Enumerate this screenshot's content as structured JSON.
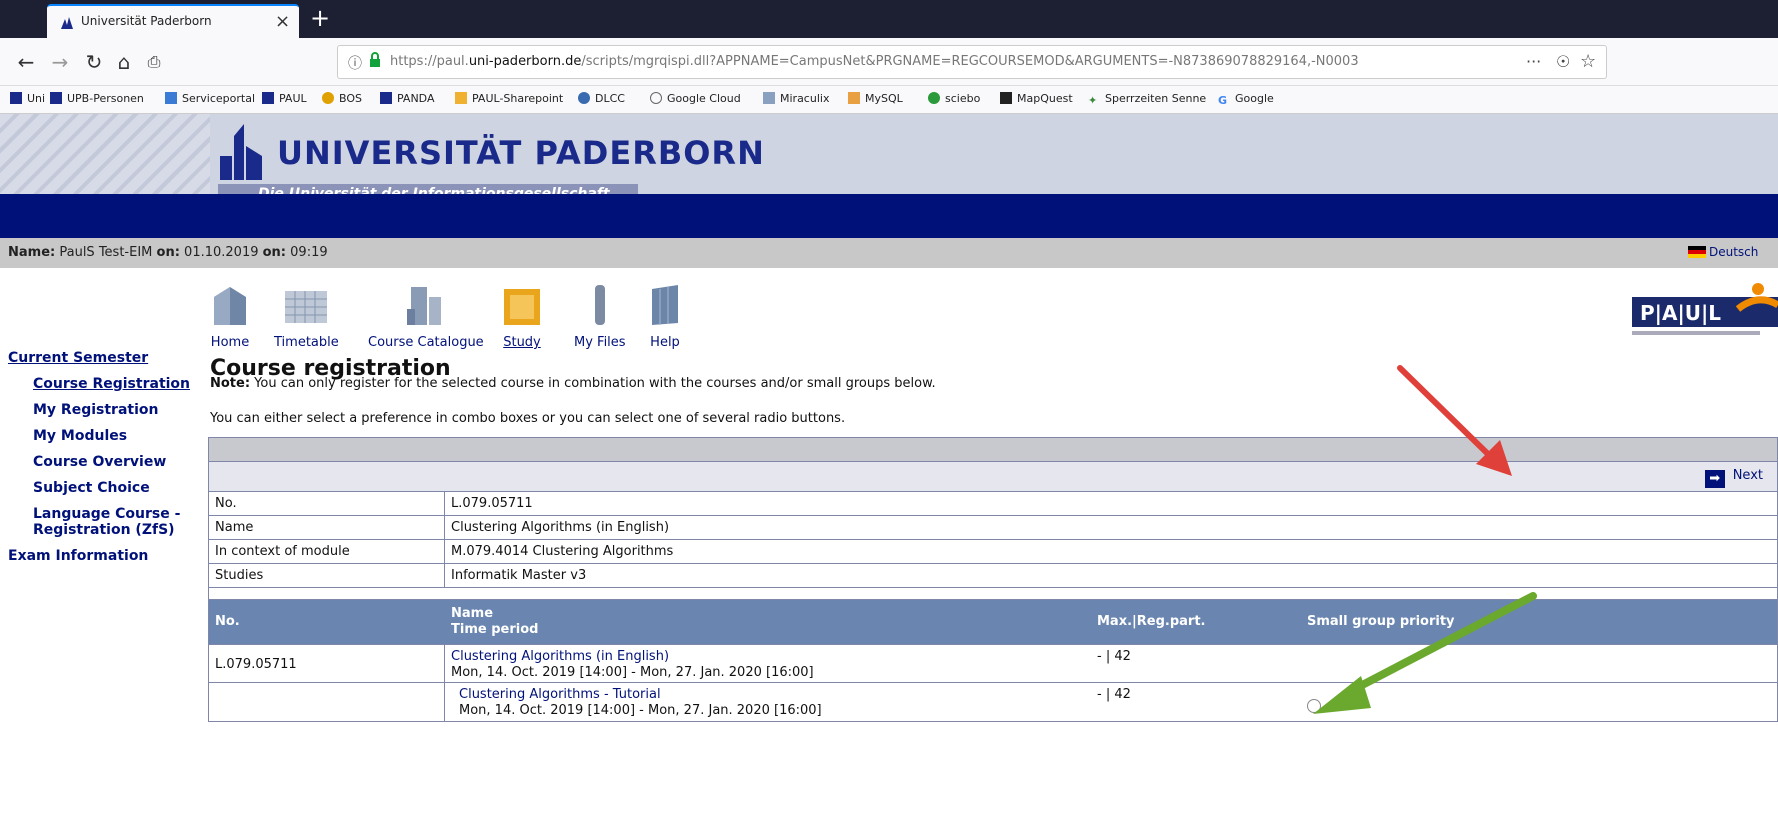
{
  "browser": {
    "tab_title": "Universität Paderborn",
    "tab_close": "×",
    "new_tab": "+",
    "url_prefix": "https://paul.",
    "url_domain": "uni-paderborn.de",
    "url_rest": "/scripts/mgrqispi.dll?APPNAME=CampusNet&PRGNAME=REGCOURSEMOD&ARGUMENTS=-N873869078829164,-N0003",
    "bookmarks": [
      "Uni",
      "UPB-Personen",
      "Serviceportal",
      "PAUL",
      "BOS",
      "PANDA",
      "PAUL-Sharepoint",
      "DLCC",
      "Google Cloud",
      "Miraculix",
      "MySQL",
      "sciebo",
      "MapQuest",
      "Sperrzeiten Senne",
      "Google"
    ]
  },
  "header": {
    "uni_name": "UNIVERSITÄT PADERBORN",
    "uni_sub": "Die Universität der Informationsgesellschaft"
  },
  "infobar": {
    "name_label": "Name:",
    "name_value": "PaulS Test-EIM",
    "on1_label": "on:",
    "date": "01.10.2019",
    "on2_label": "on:",
    "time": "09:19",
    "language": "Deutsch"
  },
  "nav": {
    "home": "Home",
    "timetable": "Timetable",
    "catalogue": "Course Catalogue",
    "study": "Study",
    "files": "My Files",
    "help": "Help"
  },
  "sidebar": {
    "current_semester": "Current Semester",
    "course_registration": "Course Registration",
    "my_registration": "My Registration",
    "my_modules": "My Modules",
    "course_overview": "Course Overview",
    "subject_choice": "Subject Choice",
    "language_course_1": "Language Course -",
    "language_course_2": "Registration (ZfS)",
    "exam_information": "Exam Information"
  },
  "main": {
    "title": "Course registration",
    "note_label": "Note:",
    "note_text": " You can only register for the selected course in combination with the courses and/or small groups below.",
    "hint": "You can either select a preference in combo boxes or you can select one of several radio buttons.",
    "next": "Next",
    "info": {
      "no_label": "No.",
      "no_value": "L.079.05711",
      "name_label": "Name",
      "name_value": "Clustering Algorithms (in English)",
      "module_label": "In context of module",
      "module_value": "M.079.4014 Clustering Algorithms",
      "studies_label": "Studies",
      "studies_value": "Informatik Master v3"
    },
    "columns": {
      "no": "No.",
      "name": "Name",
      "time": "Time period",
      "max": "Max.|Reg.part.",
      "priority": "Small group priority"
    },
    "rows": [
      {
        "no": "L.079.05711",
        "name": "Clustering Algorithms (in English)",
        "time": "Mon, 14. Oct. 2019 [14:00] - Mon, 27. Jan. 2020 [16:00]",
        "max": "- | 42"
      },
      {
        "no": "",
        "name": "Clustering Algorithms - Tutorial",
        "time": "Mon, 14. Oct. 2019 [14:00] - Mon, 27. Jan. 2020 [16:00]",
        "max": "- | 42"
      }
    ]
  }
}
